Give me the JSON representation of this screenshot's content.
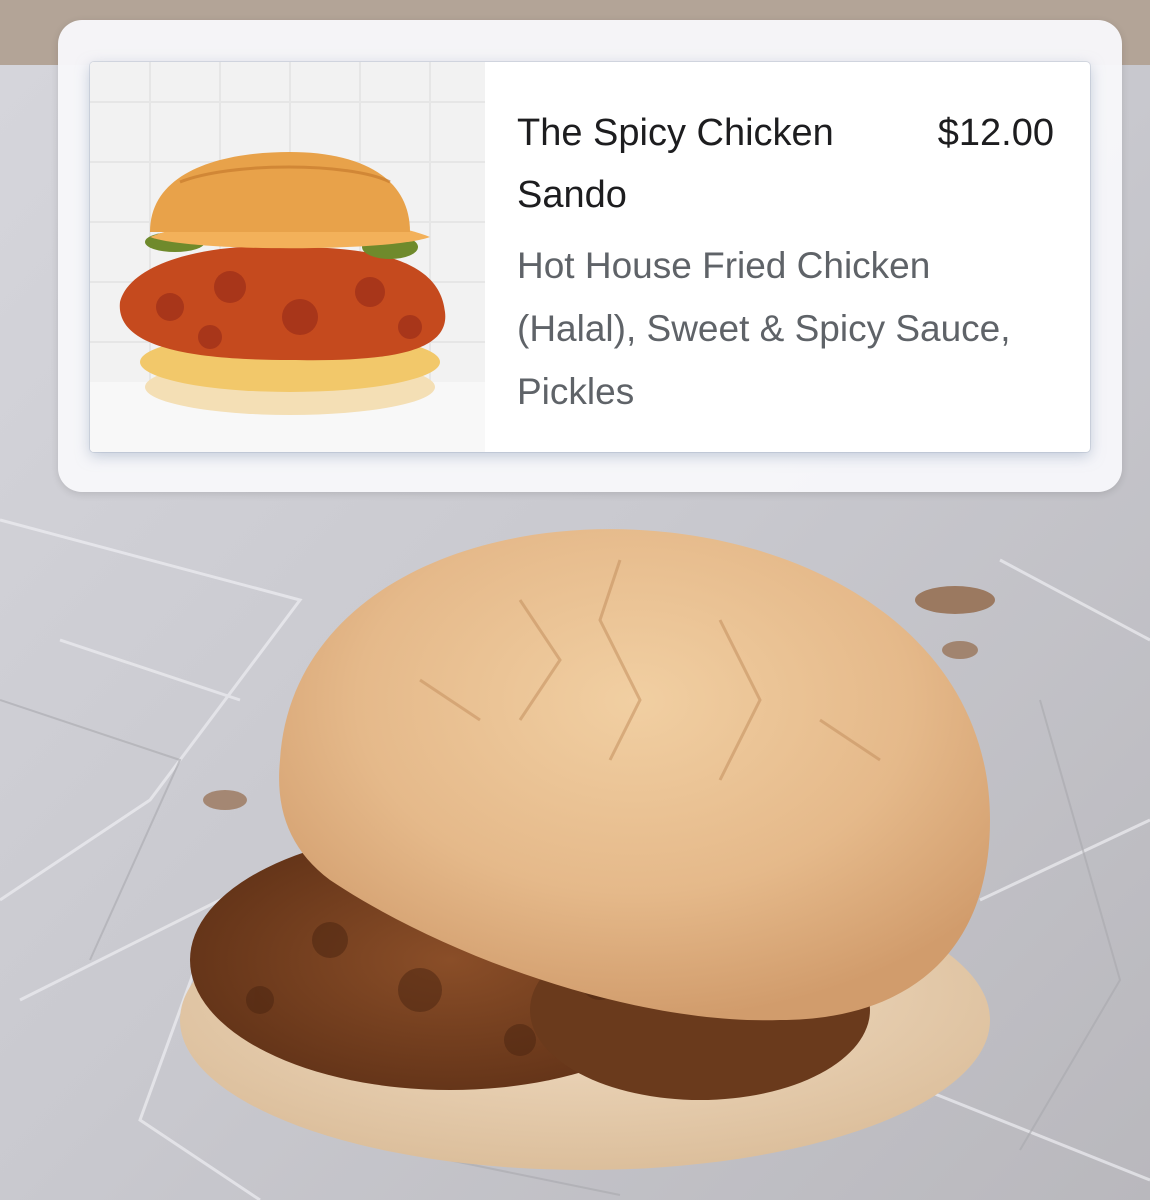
{
  "menu_item": {
    "title": "The Spicy Chicken Sando",
    "price": "$12.00",
    "description": "Hot House Fried Chicken (Halal), Sweet & Spicy Sauce, Pickles"
  },
  "images": {
    "thumbnail": "spicy-chicken-sandwich-menu-photo",
    "background": "chicken-sandwich-on-foil-wrapper-photo"
  }
}
